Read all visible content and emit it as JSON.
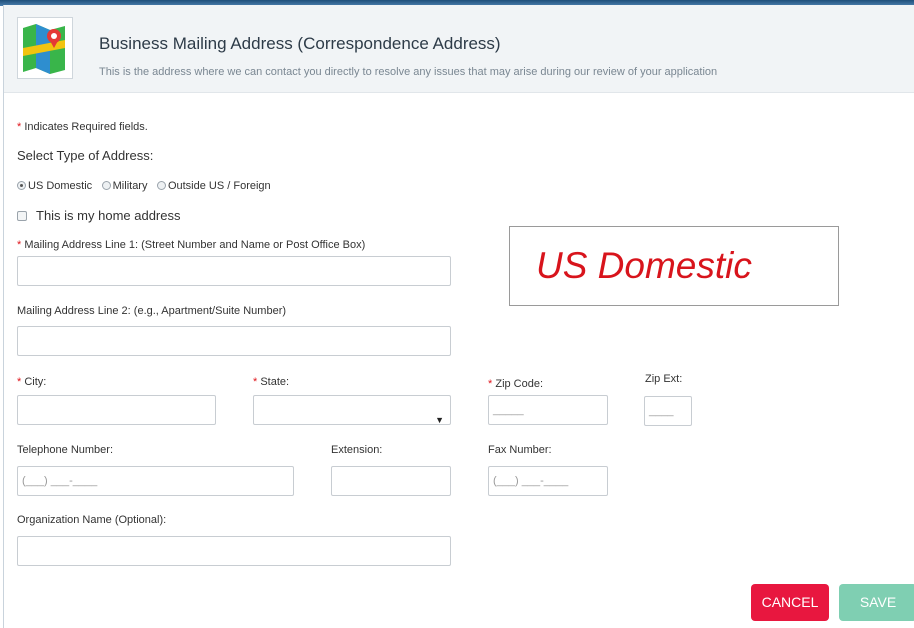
{
  "header": {
    "title": "Business Mailing Address (Correspondence Address)",
    "subtitle": "This is the address where we can contact you directly to resolve any issues that may arise during our review of your application",
    "logo_icon": "map-icon"
  },
  "form": {
    "required_note_star": "*",
    "required_note": "Indicates Required fields.",
    "address_type_label": "Select Type of Address:",
    "address_type_options": [
      "US Domestic",
      "Military",
      "Outside US / Foreign"
    ],
    "address_type_selected": "US Domestic",
    "home_address_label": "This is my home address",
    "home_address_checked": false,
    "line1_label": "Mailing Address Line 1: (Street Number and Name or Post Office Box)",
    "line2_label": "Mailing Address Line 2: (e.g., Apartment/Suite Number)",
    "city_label": "City:",
    "state_label": "State:",
    "zip_label": "Zip Code:",
    "zip_placeholder": "_____",
    "zipext_label": "Zip Ext:",
    "zipext_placeholder": "____",
    "phone_label": "Telephone Number:",
    "phone_placeholder": "(___) ___-____",
    "extension_label": "Extension:",
    "fax_label": "Fax Number:",
    "fax_placeholder": "(___) ___-____",
    "org_label": "Organization Name (Optional):"
  },
  "badge": {
    "text": "US Domestic"
  },
  "buttons": {
    "cancel": "CANCEL",
    "save": "SAVE"
  },
  "colors": {
    "required": "#e0151b",
    "cancel": "#e8173f",
    "save": "#7fcfb2",
    "badge_text": "#d8141c"
  }
}
